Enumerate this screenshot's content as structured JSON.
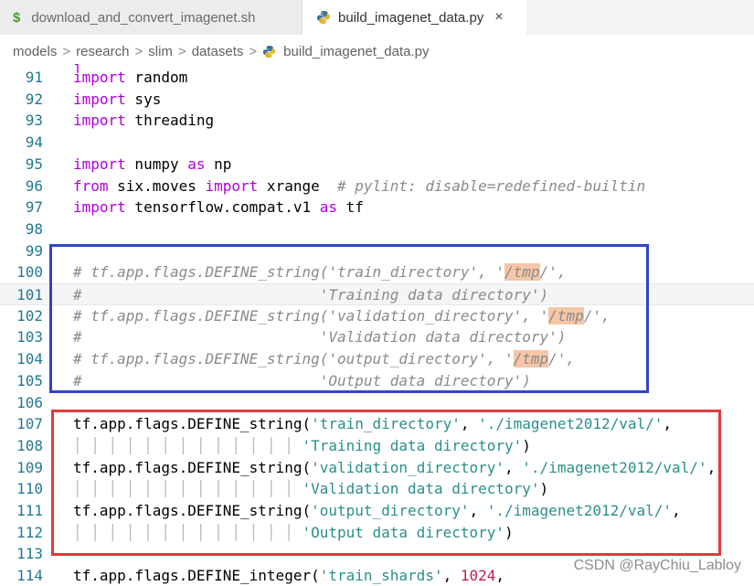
{
  "tabs": [
    {
      "icon": "$",
      "label": "download_and_convert_imagenet.sh",
      "active": false
    },
    {
      "icon": "python-icon",
      "label": "build_imagenet_data.py",
      "close": "×",
      "active": true
    }
  ],
  "breadcrumb": {
    "items": [
      "models",
      "research",
      "slim",
      "datasets",
      "build_imagenet_data.py"
    ],
    "separator": ">"
  },
  "colors": {
    "keyword": "#af00db",
    "string": "#2a8f8a",
    "number": "#c2185b",
    "comment": "#8a8a8a",
    "line_number": "#237893",
    "blue_box": "#3244c7",
    "red_box": "#e03a3a"
  },
  "editor": {
    "lines": [
      {
        "n": "91",
        "parts": [
          [
            "kw",
            "import"
          ],
          [
            "",
            " random"
          ]
        ]
      },
      {
        "n": "92",
        "parts": [
          [
            "kw",
            "import"
          ],
          [
            "",
            " sys"
          ]
        ]
      },
      {
        "n": "93",
        "parts": [
          [
            "kw",
            "import"
          ],
          [
            "",
            " threading"
          ]
        ]
      },
      {
        "n": "94",
        "parts": []
      },
      {
        "n": "95",
        "parts": [
          [
            "kw",
            "import"
          ],
          [
            "",
            " numpy "
          ],
          [
            "kw",
            "as"
          ],
          [
            "",
            " np"
          ]
        ]
      },
      {
        "n": "96",
        "parts": [
          [
            "kw",
            "from"
          ],
          [
            "",
            " six.moves "
          ],
          [
            "kw",
            "import"
          ],
          [
            "",
            " xrange  "
          ],
          [
            "cmt",
            "# pylint: disable=redefined-builtin"
          ]
        ]
      },
      {
        "n": "97",
        "parts": [
          [
            "kw",
            "import"
          ],
          [
            "",
            " tensorflow.compat.v1 "
          ],
          [
            "kw",
            "as"
          ],
          [
            "",
            " tf"
          ]
        ]
      },
      {
        "n": "98",
        "parts": []
      },
      {
        "n": "99",
        "parts": []
      },
      {
        "n": "100",
        "parts": [
          [
            "cmt",
            "# tf.app.flags.DEFINE_string('train_directory', '"
          ],
          [
            "cmt tmp",
            "/tmp"
          ],
          [
            "cmt",
            "/',"
          ]
        ]
      },
      {
        "n": "101",
        "hl": true,
        "parts": [
          [
            "cmt",
            "#                           'Training data directory')"
          ]
        ]
      },
      {
        "n": "102",
        "parts": [
          [
            "cmt",
            "# tf.app.flags.DEFINE_string('validation_directory', '"
          ],
          [
            "cmt tmp",
            "/tmp"
          ],
          [
            "cmt",
            "/',"
          ]
        ]
      },
      {
        "n": "103",
        "parts": [
          [
            "cmt",
            "#                           'Validation data directory')"
          ]
        ]
      },
      {
        "n": "104",
        "parts": [
          [
            "cmt",
            "# tf.app.flags.DEFINE_string('output_directory', '"
          ],
          [
            "cmt tmp",
            "/tmp"
          ],
          [
            "cmt",
            "/',"
          ]
        ]
      },
      {
        "n": "105",
        "parts": [
          [
            "cmt",
            "#                           'Output data directory')"
          ]
        ]
      },
      {
        "n": "106",
        "parts": []
      },
      {
        "n": "107",
        "parts": [
          [
            "",
            "tf.app.flags.DEFINE_string("
          ],
          [
            "str",
            "'train_directory'"
          ],
          [
            "",
            ", "
          ],
          [
            "str",
            "'./imagenet2012/val/'"
          ],
          [
            "",
            ","
          ]
        ]
      },
      {
        "n": "108",
        "parts": [
          [
            "guides",
            "│ │ │ │ │ │ │ │ │ │ │ │ │ "
          ],
          [
            "str",
            "'Training data directory'"
          ],
          [
            "",
            ")"
          ]
        ]
      },
      {
        "n": "109",
        "parts": [
          [
            "",
            "tf.app.flags.DEFINE_string("
          ],
          [
            "str",
            "'validation_directory'"
          ],
          [
            "",
            ", "
          ],
          [
            "str",
            "'./imagenet2012/val/'"
          ],
          [
            "",
            ","
          ]
        ]
      },
      {
        "n": "110",
        "parts": [
          [
            "guides",
            "│ │ │ │ │ │ │ │ │ │ │ │ │ "
          ],
          [
            "str",
            "'Validation data directory'"
          ],
          [
            "",
            ")"
          ]
        ]
      },
      {
        "n": "111",
        "parts": [
          [
            "",
            "tf.app.flags.DEFINE_string("
          ],
          [
            "str",
            "'output_directory'"
          ],
          [
            "",
            ", "
          ],
          [
            "str",
            "'./imagenet2012/val/'"
          ],
          [
            "",
            ","
          ]
        ]
      },
      {
        "n": "112",
        "parts": [
          [
            "guides",
            "│ │ │ │ │ │ │ │ │ │ │ │ │ "
          ],
          [
            "str",
            "'Output data directory'"
          ],
          [
            "",
            ")"
          ]
        ]
      },
      {
        "n": "113",
        "parts": []
      },
      {
        "n": "114",
        "parts": [
          [
            "",
            "tf.app.flags.DEFINE_integer("
          ],
          [
            "str",
            "'train_shards'"
          ],
          [
            "",
            ", "
          ],
          [
            "num",
            "1024"
          ],
          [
            "",
            ","
          ]
        ]
      }
    ]
  },
  "watermark": "CSDN @RayChiu_Labloy"
}
